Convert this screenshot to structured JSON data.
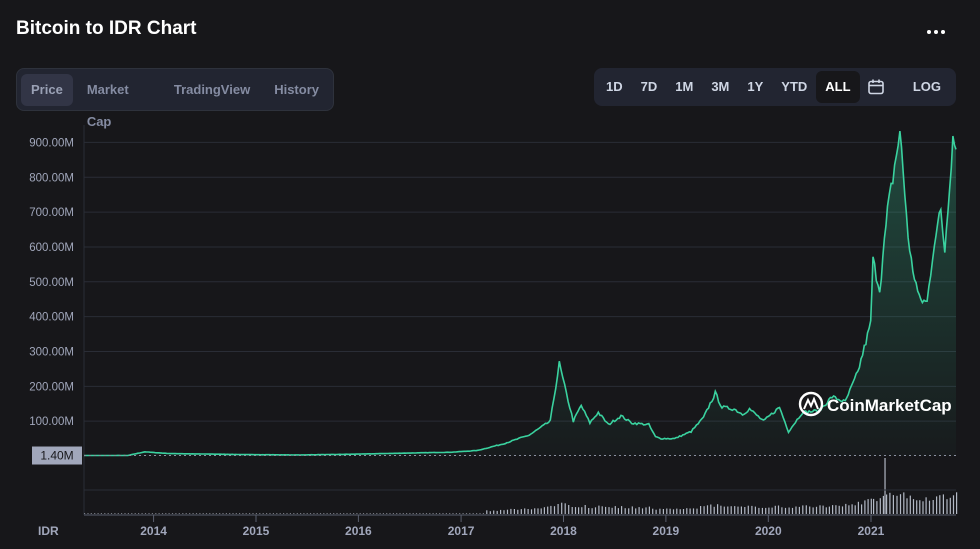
{
  "header": {
    "title": "Bitcoin to IDR Chart",
    "more_icon": "more-dots-icon"
  },
  "tabs": [
    {
      "label": "Price",
      "active": true
    },
    {
      "label": "Market Cap",
      "active": false
    },
    {
      "label": "TradingView",
      "active": false
    },
    {
      "label": "History",
      "active": false
    }
  ],
  "ranges": [
    "1D",
    "7D",
    "1M",
    "3M",
    "1Y",
    "YTD",
    "ALL"
  ],
  "active_range": "ALL",
  "calendar_icon": "calendar-icon",
  "log_label": "LOG",
  "currency_label": "IDR",
  "watermark": "CoinMarketCap",
  "colors": {
    "line": "#3ad29f",
    "bg": "#17171a",
    "grid": "#2a2d36",
    "axis_text": "#a1a7bb",
    "badge": "#a1a7bb"
  },
  "chart_data": {
    "type": "area",
    "title": "Bitcoin to IDR Chart",
    "ylabel": "",
    "xlabel": "",
    "ylim": [
      0,
      950
    ],
    "y_unit": "M IDR",
    "y_ticks": [
      "100.00M",
      "200.00M",
      "300.00M",
      "400.00M",
      "500.00M",
      "600.00M",
      "700.00M",
      "800.00M",
      "900.00M"
    ],
    "y_tick_values": [
      100,
      200,
      300,
      400,
      500,
      600,
      700,
      800,
      900
    ],
    "x_ticks": [
      "2014",
      "2015",
      "2016",
      "2017",
      "2018",
      "2019",
      "2020",
      "2021"
    ],
    "baseline_label": "1.40M",
    "baseline_value": 1.4,
    "x_range": [
      "2013-04-28",
      "2021-10-31"
    ],
    "series": [
      {
        "points": [
          [
            "2013-04-28",
            1.4
          ],
          [
            "2013-10-01",
            1.5
          ],
          [
            "2013-12-01",
            12
          ],
          [
            "2014-01-01",
            10
          ],
          [
            "2014-03-01",
            7
          ],
          [
            "2014-06-01",
            6
          ],
          [
            "2014-12-01",
            4
          ],
          [
            "2015-06-01",
            3
          ],
          [
            "2015-12-01",
            5
          ],
          [
            "2016-06-01",
            8
          ],
          [
            "2016-12-01",
            11
          ],
          [
            "2017-03-01",
            16
          ],
          [
            "2017-06-01",
            35
          ],
          [
            "2017-09-01",
            60
          ],
          [
            "2017-11-15",
            100
          ],
          [
            "2017-12-17",
            265
          ],
          [
            "2018-01-05",
            200
          ],
          [
            "2018-02-05",
            100
          ],
          [
            "2018-03-05",
            145
          ],
          [
            "2018-04-05",
            95
          ],
          [
            "2018-05-05",
            125
          ],
          [
            "2018-06-10",
            90
          ],
          [
            "2018-07-25",
            115
          ],
          [
            "2018-09-01",
            95
          ],
          [
            "2018-11-01",
            90
          ],
          [
            "2018-11-25",
            55
          ],
          [
            "2018-12-15",
            50
          ],
          [
            "2019-02-01",
            50
          ],
          [
            "2019-04-01",
            70
          ],
          [
            "2019-05-15",
            110
          ],
          [
            "2019-06-26",
            180
          ],
          [
            "2019-07-20",
            140
          ],
          [
            "2019-09-01",
            135
          ],
          [
            "2019-10-01",
            120
          ],
          [
            "2019-10-26",
            135
          ],
          [
            "2019-12-15",
            100
          ],
          [
            "2020-02-10",
            140
          ],
          [
            "2020-03-13",
            70
          ],
          [
            "2020-05-01",
            125
          ],
          [
            "2020-07-01",
            130
          ],
          [
            "2020-08-15",
            170
          ],
          [
            "2020-10-01",
            155
          ],
          [
            "2020-11-15",
            240
          ],
          [
            "2020-12-31",
            380
          ],
          [
            "2021-01-08",
            560
          ],
          [
            "2021-02-01",
            480
          ],
          [
            "2021-03-01",
            700
          ],
          [
            "2021-04-14",
            930
          ],
          [
            "2021-05-19",
            580
          ],
          [
            "2021-06-22",
            450
          ],
          [
            "2021-07-20",
            440
          ],
          [
            "2021-08-15",
            620
          ],
          [
            "2021-09-07",
            700
          ],
          [
            "2021-09-21",
            590
          ],
          [
            "2021-10-20",
            920
          ],
          [
            "2021-10-31",
            880
          ]
        ]
      }
    ]
  }
}
